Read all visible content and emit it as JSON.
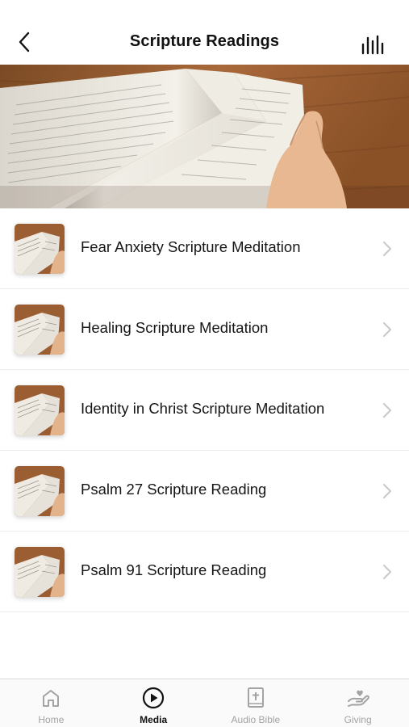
{
  "header": {
    "title": "Scripture Readings",
    "back_icon": "chevron-left-icon",
    "right_icon": "audio-bars-icon"
  },
  "hero": {
    "image": "open-bible-photo"
  },
  "items": [
    {
      "label": "Fear Anxiety Scripture Meditation",
      "thumb": "open-bible-thumbnail"
    },
    {
      "label": "Healing Scripture Meditation",
      "thumb": "open-bible-thumbnail"
    },
    {
      "label": "Identity in Christ Scripture Meditation",
      "thumb": "open-bible-thumbnail"
    },
    {
      "label": "Psalm 27 Scripture Reading",
      "thumb": "open-bible-thumbnail"
    },
    {
      "label": "Psalm 91 Scripture Reading",
      "thumb": "open-bible-thumbnail"
    }
  ],
  "tabbar": {
    "active": "Media",
    "tabs": [
      {
        "label": "Home",
        "icon": "home-icon"
      },
      {
        "label": "Media",
        "icon": "play-circle-icon"
      },
      {
        "label": "Audio Bible",
        "icon": "bible-icon"
      },
      {
        "label": "Giving",
        "icon": "giving-hand-icon"
      }
    ]
  },
  "colors": {
    "active_tab": "#111111",
    "inactive_tab": "#a3a3a3",
    "chevron": "#c7c7cc",
    "divider": "#ececec"
  }
}
